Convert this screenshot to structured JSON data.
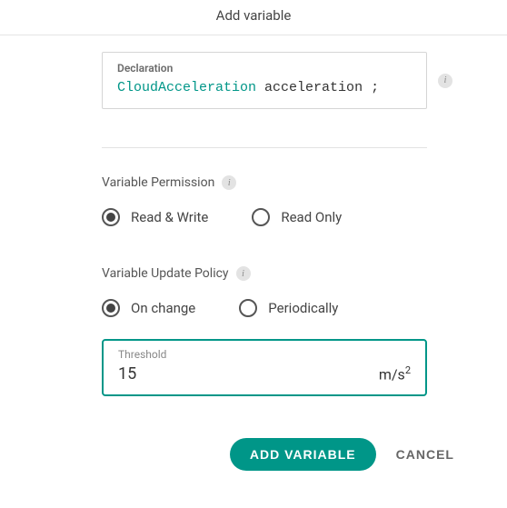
{
  "header": {
    "title": "Add variable"
  },
  "declaration": {
    "label": "Declaration",
    "type": "CloudAcceleration",
    "name": "acceleration",
    "terminator": ";"
  },
  "permission": {
    "label": "Variable Permission",
    "options": [
      {
        "label": "Read & Write",
        "selected": true
      },
      {
        "label": "Read Only",
        "selected": false
      }
    ]
  },
  "updatePolicy": {
    "label": "Variable Update Policy",
    "options": [
      {
        "label": "On change",
        "selected": true
      },
      {
        "label": "Periodically",
        "selected": false
      }
    ]
  },
  "threshold": {
    "label": "Threshold",
    "value": "15",
    "unit_base": "m/s",
    "unit_exp": "2"
  },
  "footer": {
    "primary": "ADD VARIABLE",
    "cancel": "CANCEL"
  }
}
